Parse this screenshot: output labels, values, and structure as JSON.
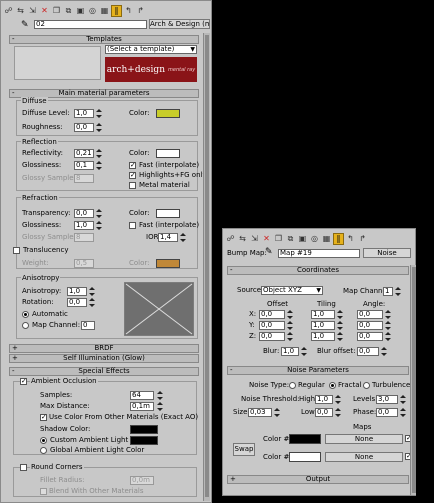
{
  "left": {
    "material_name": "02",
    "material_type": "Arch & Design (mi)",
    "templates": {
      "title": "Templates",
      "select": "(Select a template)",
      "logo": "arch+design",
      "logo_sub": "mental ray"
    },
    "main": {
      "title": "Main material parameters",
      "diffuse": {
        "title": "Diffuse",
        "level_label": "Diffuse Level:",
        "level": "1,0",
        "rough_label": "Roughness:",
        "rough": "0,0",
        "color_label": "Color:",
        "color": "#c8cd2a"
      },
      "reflection": {
        "title": "Reflection",
        "refl_label": "Reflectivity:",
        "refl": "0,21",
        "gloss_label": "Glossiness:",
        "gloss": "0,1",
        "samples_label": "Glossy Samples:",
        "samples": "8",
        "color_label": "Color:",
        "color": "#ffffff",
        "fast": "Fast (interpolate)",
        "hl": "Highlights+FG only",
        "metal": "Metal material"
      },
      "refraction": {
        "title": "Refraction",
        "trans_label": "Transparency:",
        "trans": "0,0",
        "gloss_label": "Glossiness:",
        "gloss": "1,0",
        "samples_label": "Glossy Samples:",
        "samples": "8",
        "color_label": "Color:",
        "color": "#ffffff",
        "fast": "Fast (interpolate)",
        "ior_label": "IOR:",
        "ior": "1,4",
        "transluc": "Translucency",
        "weight_label": "Weight:",
        "weight": "0,5",
        "color2_label": "Color:",
        "color2": "#c08838"
      },
      "aniso": {
        "title": "Anisotropy",
        "an_label": "Anisotropy:",
        "an": "1,0",
        "rot_label": "Rotation:",
        "rot": "0,0",
        "auto": "Automatic",
        "mapch": "Map Channel:",
        "mapch_val": "0"
      }
    },
    "brdf": "BRDF",
    "selfillum": "Self Illumination (Glow)",
    "special": {
      "title": "Special Effects",
      "ao": "Ambient Occlusion",
      "samples_label": "Samples:",
      "samples": "64",
      "maxd_label": "Max Distance:",
      "maxd": "0,1m",
      "use_color": "Use Color From Other Materials (Exact AO)",
      "shadow_label": "Shadow Color:",
      "custom": "Custom Ambient Light",
      "global": "Global Ambient Light Color"
    },
    "round": {
      "title": "Round Corners",
      "fillet_label": "Fillet Radius:",
      "fillet": "0,0m",
      "blend": "Blend With Other Materials"
    }
  },
  "right": {
    "bump_label": "Bump Map:",
    "map_name": "Map #19",
    "map_type": "Noise",
    "coords": {
      "title": "Coordinates",
      "source_label": "Source:",
      "source": "Object XYZ",
      "mapch_label": "Map Channel:",
      "mapch": "1",
      "offset": "Offset",
      "tiling": "Tiling",
      "angle": "Angle:",
      "x": "X:",
      "y": "Y:",
      "z": "Z:",
      "ox": "0,0",
      "oy": "0,0",
      "oz": "0,0",
      "tx": "1,0",
      "ty": "1,0",
      "tz": "1,0",
      "ax": "0,0",
      "ay": "0,0",
      "az": "0,0",
      "blur_label": "Blur:",
      "blur": "1,0",
      "blur_off_label": "Blur offset:",
      "blur_off": "0,0"
    },
    "noise": {
      "title": "Noise Parameters",
      "type_label": "Noise Type:",
      "regular": "Regular",
      "fractal": "Fractal",
      "turbulence": "Turbulence",
      "thr_label": "Noise Threshold:",
      "high_label": "High:",
      "high": "1,0",
      "levels_label": "Levels:",
      "levels": "3,0",
      "size_label": "Size:",
      "size": "0,03",
      "low_label": "Low:",
      "low": "0,0",
      "phase_label": "Phase:",
      "phase": "0,0",
      "maps": "Maps",
      "swap": "Swap",
      "c1": "Color #1",
      "c2": "Color #2",
      "none1": "None",
      "none2": "None",
      "col1": "#000000",
      "col2": "#ffffff"
    },
    "output": "Output"
  }
}
